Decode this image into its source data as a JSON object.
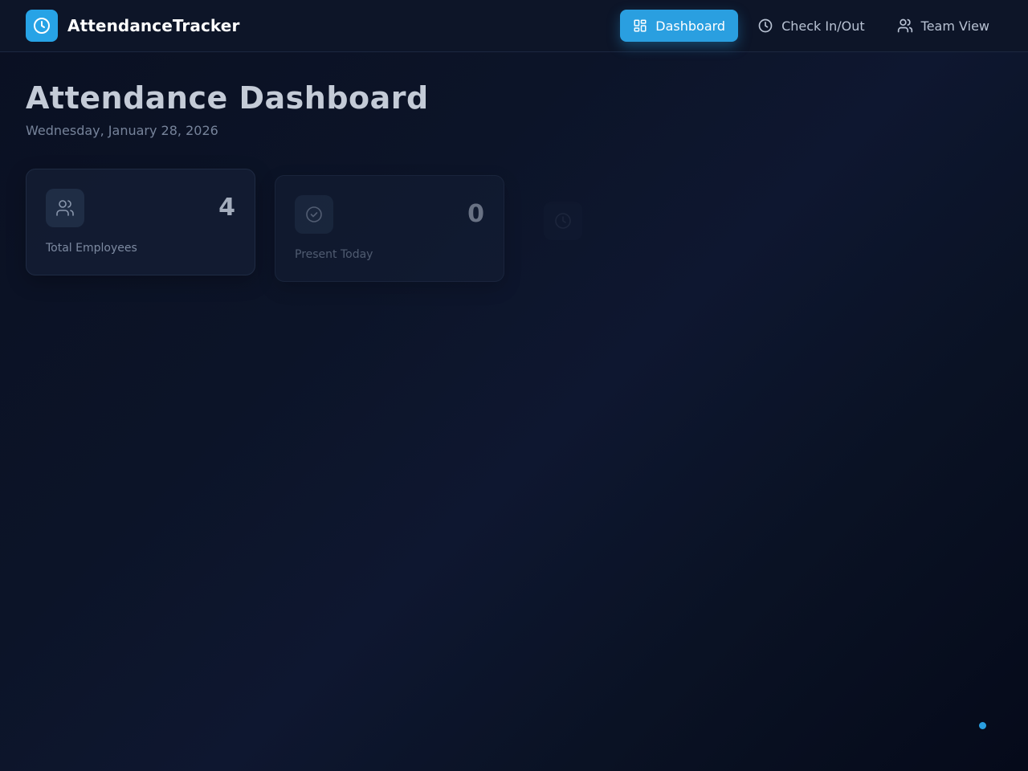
{
  "app": {
    "name": "AttendanceTracker",
    "logo_icon": "clock-icon",
    "accent": "#27a3e6"
  },
  "nav": {
    "items": [
      {
        "label": "Dashboard",
        "icon": "grid-icon",
        "active": true
      },
      {
        "label": "Check In/Out",
        "icon": "clock-icon",
        "active": false
      },
      {
        "label": "Team View",
        "icon": "users-icon",
        "active": false
      }
    ]
  },
  "page": {
    "title": "Attendance Dashboard",
    "date": "Wednesday, January 28, 2026"
  },
  "stats": [
    {
      "label": "Total Employees",
      "value": "4",
      "icon": "users-icon"
    },
    {
      "label": "Present Today",
      "value": "0",
      "icon": "check-circle-icon"
    },
    {
      "label": "",
      "value": "",
      "icon": "clock-icon"
    }
  ]
}
